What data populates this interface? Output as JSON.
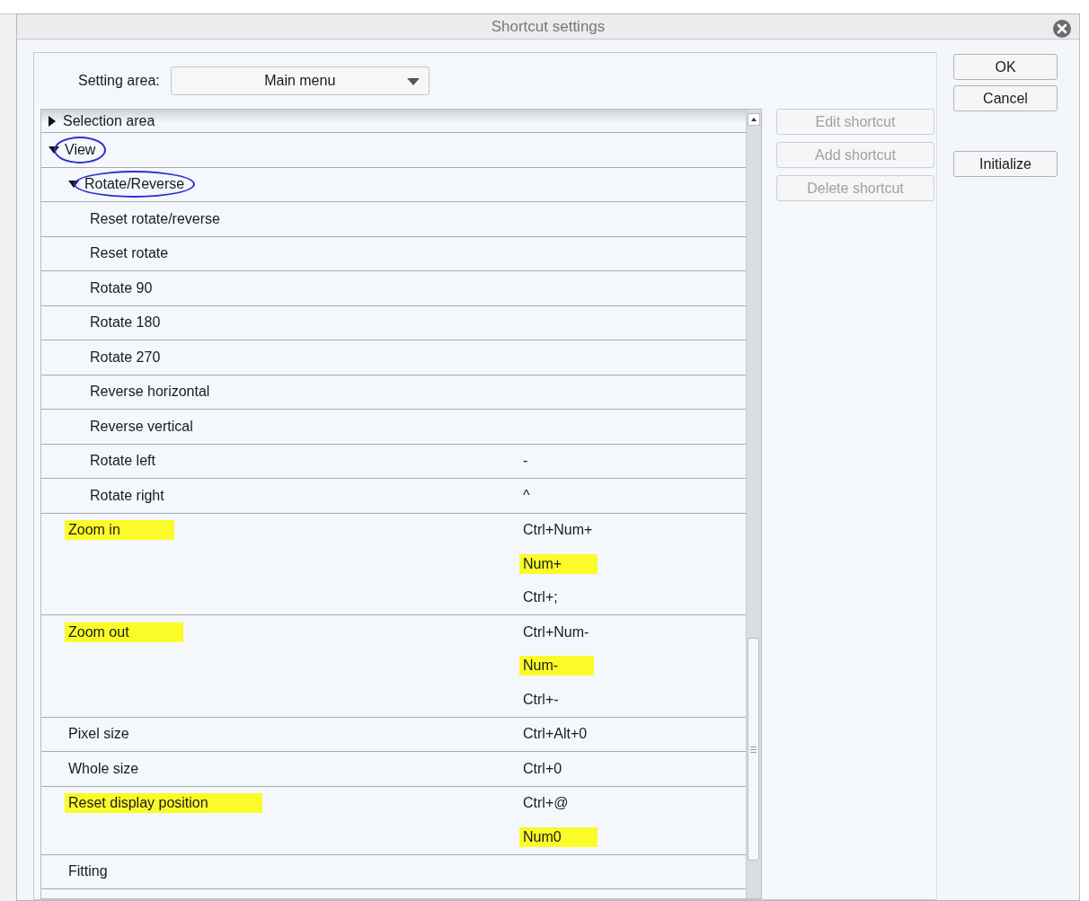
{
  "window": {
    "title": "Shortcut settings"
  },
  "setting_area": {
    "label": "Setting area:",
    "value": "Main menu"
  },
  "tree": [
    {
      "kind": "group",
      "name": "Selection area",
      "expanded": false,
      "circled": false,
      "highlighted": false
    },
    {
      "kind": "group",
      "name": "View",
      "expanded": true,
      "circled": true,
      "highlighted": false,
      "children": [
        {
          "kind": "group",
          "name": "Rotate/Reverse",
          "expanded": true,
          "circled": true,
          "highlighted": false,
          "children": [
            {
              "kind": "command",
              "name": "Reset rotate/reverse",
              "highlighted": false
            },
            {
              "kind": "command",
              "name": "Reset rotate",
              "highlighted": false
            },
            {
              "kind": "command",
              "name": "Rotate 90",
              "highlighted": false
            },
            {
              "kind": "command",
              "name": "Rotate 180",
              "highlighted": false
            },
            {
              "kind": "command",
              "name": "Rotate 270",
              "highlighted": false
            },
            {
              "kind": "command",
              "name": "Reverse horizontal",
              "highlighted": false
            },
            {
              "kind": "command",
              "name": "Reverse vertical",
              "highlighted": false
            },
            {
              "kind": "command",
              "name": "Rotate left",
              "highlighted": false,
              "shortcuts": [
                {
                  "keys": "-",
                  "highlighted": false
                }
              ]
            },
            {
              "kind": "command",
              "name": "Rotate right",
              "highlighted": false,
              "shortcuts": [
                {
                  "keys": "^",
                  "highlighted": false
                }
              ]
            }
          ]
        },
        {
          "kind": "command",
          "name": "Zoom in",
          "highlighted": true,
          "shortcuts": [
            {
              "keys": "Ctrl+Num+",
              "highlighted": false
            },
            {
              "keys": "Num+",
              "highlighted": true
            },
            {
              "keys": "Ctrl+;",
              "highlighted": false
            }
          ]
        },
        {
          "kind": "command",
          "name": "Zoom out",
          "highlighted": true,
          "shortcuts": [
            {
              "keys": "Ctrl+Num-",
              "highlighted": false
            },
            {
              "keys": "Num-",
              "highlighted": true
            },
            {
              "keys": "Ctrl+-",
              "highlighted": false
            }
          ]
        },
        {
          "kind": "command",
          "name": "Pixel size",
          "highlighted": false,
          "shortcuts": [
            {
              "keys": "Ctrl+Alt+0",
              "highlighted": false
            }
          ]
        },
        {
          "kind": "command",
          "name": "Whole size",
          "highlighted": false,
          "shortcuts": [
            {
              "keys": "Ctrl+0",
              "highlighted": false
            }
          ]
        },
        {
          "kind": "command",
          "name": "Reset display position",
          "highlighted": true,
          "shortcuts": [
            {
              "keys": "Ctrl+@",
              "highlighted": false
            },
            {
              "keys": "Num0",
              "highlighted": true
            }
          ]
        },
        {
          "kind": "command",
          "name": "Fitting",
          "highlighted": false
        }
      ]
    }
  ],
  "shortcut_buttons": [
    {
      "label": "Edit shortcut",
      "disabled": true
    },
    {
      "label": "Add shortcut",
      "disabled": true
    },
    {
      "label": "Delete shortcut",
      "disabled": true
    }
  ],
  "dialog_buttons": [
    "OK",
    "Cancel",
    "Initialize"
  ]
}
